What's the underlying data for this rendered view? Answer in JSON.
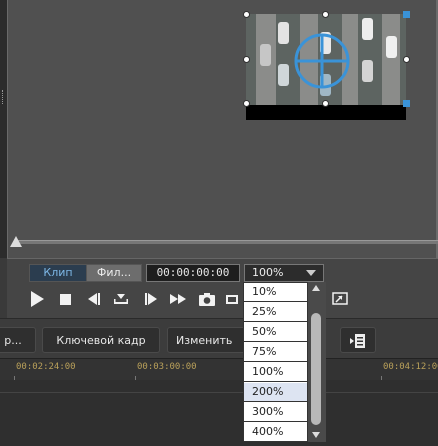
{
  "preview_tabs": {
    "clip": "Клип",
    "file": "Фил..."
  },
  "timecode": "00:00:00:00",
  "zoom": {
    "value": "100%",
    "options": [
      "10%",
      "25%",
      "50%",
      "75%",
      "100%",
      "200%",
      "300%",
      "400%"
    ],
    "highlighted": "200%"
  },
  "toolbar": {
    "cut_label": "р...",
    "keyframe_label": "Ключевой кадр",
    "change_label": "Изменить"
  },
  "ruler": {
    "labels": [
      "00:02:24:00",
      "00:03:00:00",
      "00:04:12:00"
    ]
  },
  "colors": {
    "tab_active": "#2b3d4f",
    "accent": "#3a93d8",
    "ruler_text": "#b9a05a"
  },
  "icons": [
    "play-icon",
    "stop-icon",
    "prev-frame-icon",
    "in-out-icon",
    "next-frame-icon",
    "fast-forward-icon",
    "snapshot-icon",
    "display-mode-icon",
    "fullscreen-icon",
    "list-icon"
  ]
}
